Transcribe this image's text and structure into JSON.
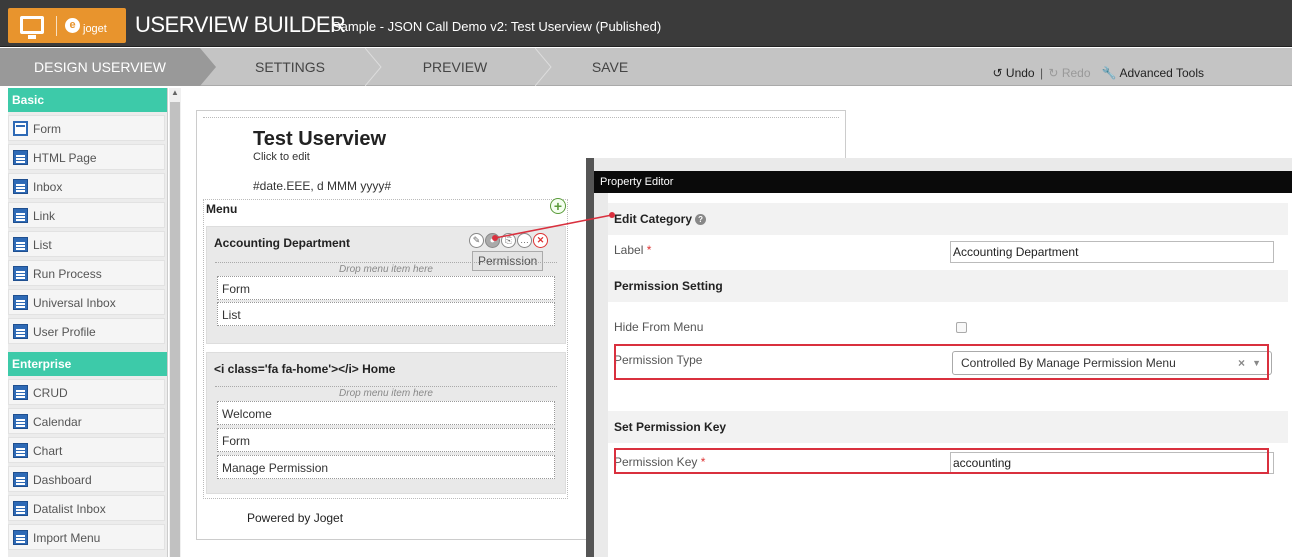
{
  "header": {
    "joget_label": "joget",
    "title": "USERVIEW BUILDER",
    "subtitle": "Sample - JSON Call Demo v2: Test Userview (Published)"
  },
  "nav": {
    "steps": [
      "DESIGN USERVIEW",
      "SETTINGS",
      "PREVIEW",
      "SAVE"
    ],
    "active": "DESIGN USERVIEW",
    "undo": "Undo",
    "separator": "|",
    "redo": "Redo",
    "advanced_tools": "Advanced Tools"
  },
  "palette": {
    "basic_header": "Basic",
    "basic_items": [
      "Form",
      "HTML Page",
      "Inbox",
      "Link",
      "List",
      "Run Process",
      "Universal Inbox",
      "User Profile"
    ],
    "enterprise_header": "Enterprise",
    "enterprise_items": [
      "CRUD",
      "Calendar",
      "Chart",
      "Dashboard",
      "Datalist Inbox",
      "Import Menu"
    ]
  },
  "canvas": {
    "title": "Test Userview",
    "click_to_edit": "Click to edit",
    "date": "#date.EEE, d MMM yyyy#",
    "menu_label": "Menu",
    "add_icon": "+",
    "categories": [
      {
        "title": "Accounting Department",
        "drop_hint": "Drop menu item here",
        "items": [
          "Form",
          "List"
        ]
      },
      {
        "title": "<i class='fa fa-home'></i> Home",
        "drop_hint": "Drop menu item here",
        "items": [
          "Welcome",
          "Form",
          "Manage Permission"
        ]
      }
    ],
    "tooltip": "Permission",
    "footer": "Powered by Joget"
  },
  "property_editor": {
    "title": "Property Editor",
    "edit_category": "Edit Category",
    "help_icon": "?",
    "label_field": "Label",
    "label_value": "Accounting Department",
    "required_mark": "*",
    "permission_setting": "Permission Setting",
    "hide_from_menu": "Hide From Menu",
    "permission_type": "Permission Type",
    "permission_type_value": "Controlled By Manage Permission Menu",
    "set_permission_key": "Set Permission Key",
    "permission_key": "Permission Key",
    "permission_key_value": "accounting"
  },
  "colors": {
    "header_bg": "#3b3b3b",
    "logo_orange": "#e8942d",
    "palette_header": "#3dcaa9",
    "highlight_red": "#d9303e"
  }
}
